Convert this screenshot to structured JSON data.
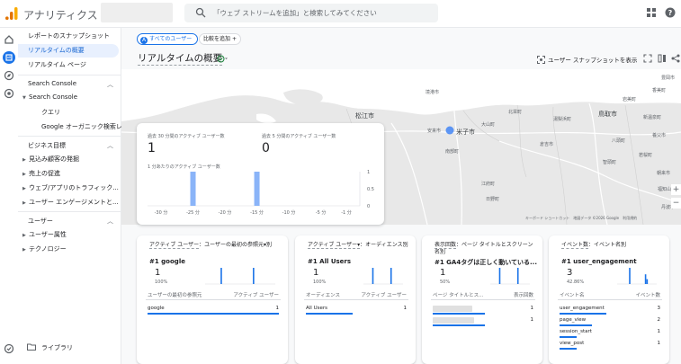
{
  "app": {
    "title": "アナリティクス"
  },
  "search": {
    "placeholder": "「ウェブ ストリームを追加」と検索してみてください"
  },
  "nav": {
    "items": [
      {
        "label": "レポートのスナップショット",
        "active": false
      },
      {
        "label": "リアルタイムの概要",
        "active": true
      },
      {
        "label": "リアルタイム ページ",
        "active": false
      }
    ],
    "sections": [
      {
        "label": "Search Console"
      },
      {
        "label": "ビジネス目標"
      },
      {
        "label": "ユーザー"
      }
    ],
    "search_console": {
      "group": "Search Console",
      "children": [
        "クエリ",
        "Google オーガニック検索レ..."
      ]
    },
    "business": [
      "見込み顧客の発掘",
      "売上の促進",
      "ウェブ/アプリのトラフィック...",
      "ユーザー エンゲージメントと..."
    ],
    "user": [
      "ユーザー属性",
      "テクノロジー"
    ],
    "library": "ライブラリ"
  },
  "toolbar": {
    "all_users_chip": "すべてのユーザー",
    "add_comparison": "比較を追加",
    "page_title": "リアルタイムの概要",
    "snapshot": "ユーザー スナップショットを表示"
  },
  "map": {
    "labels": [
      {
        "text": "松江市",
        "big": true
      },
      {
        "text": "米子市",
        "big": true
      },
      {
        "text": "鳥取市",
        "big": true
      },
      {
        "text": "倉吉市",
        "big": false
      },
      {
        "text": "安来市",
        "big": false
      },
      {
        "text": "境港市",
        "big": false
      },
      {
        "text": "大山町",
        "big": false
      },
      {
        "text": "南部町",
        "big": false
      },
      {
        "text": "江府町",
        "big": false
      },
      {
        "text": "日野町",
        "big": false
      },
      {
        "text": "八頭町",
        "big": false
      },
      {
        "text": "智頭町",
        "big": false
      },
      {
        "text": "若桜町",
        "big": false
      },
      {
        "text": "北栄町",
        "big": false
      },
      {
        "text": "湯梨浜町",
        "big": false
      },
      {
        "text": "岩美町",
        "big": false
      },
      {
        "text": "香美町",
        "big": false
      },
      {
        "text": "豊岡市",
        "big": false
      },
      {
        "text": "新温泉町",
        "big": false
      },
      {
        "text": "養父市",
        "big": false
      },
      {
        "text": "朝来市",
        "big": false
      },
      {
        "text": "丹波市",
        "big": false
      },
      {
        "text": "福知山市",
        "big": false
      }
    ],
    "footer": "キーボード ショートカット　地図データ ©2026 Google　利用規約"
  },
  "overview": {
    "metric30_label": "過去 30 分間のアクティブ ユーザー数",
    "metric30_value": "1",
    "metric5_label": "過去 5 分間のアクティブ ユーザー数",
    "metric5_value": "0",
    "per_minute_label": "1 分あたりのアクティブ ユーザー数",
    "chart_data": {
      "type": "bar",
      "x_ticks": [
        "-30 分",
        "-25 分",
        "-20 分",
        "-15 分",
        "-10 分",
        "-5 分",
        "-1 分"
      ],
      "y_ticks": [
        "1",
        "0.5",
        "0"
      ],
      "ylim": [
        0,
        1
      ],
      "bars": [
        {
          "minute": -25,
          "value": 1
        },
        {
          "minute": -15,
          "value": 1
        }
      ]
    }
  },
  "cards": [
    {
      "title_prefix": "アクティブ ユーザー",
      "title_suffix": "：ユーザーの最初の参照元▾別",
      "rank_label": "#1 google",
      "big": "1",
      "pct": "100%",
      "col1": "ユーザーの最初の参照元",
      "col2": "アクティブ ユーザー",
      "rows": [
        {
          "label": "google",
          "value": "1"
        }
      ]
    },
    {
      "title_prefix": "アクティブ ユーザー▾",
      "title_suffix": "：オーディエンス別",
      "rank_label": "#1 All Users",
      "big": "1",
      "pct": "100%",
      "col1": "オーディエンス",
      "col2": "アクティブ ユーザー",
      "rows": [
        {
          "label": "All Users",
          "value": "1"
        }
      ]
    },
    {
      "title_prefix": "表示回数",
      "title_suffix": "：ページ タイトルとスクリーン名別",
      "rank_label": "#1 GA4タグは正しく動いている...",
      "big": "1",
      "pct": "50%",
      "col1": "ページ タイトルとス...",
      "col2": "表示回数",
      "rows": [
        {
          "label": "",
          "value": "1"
        },
        {
          "label": "",
          "value": "1"
        }
      ]
    },
    {
      "title_prefix": "イベント数",
      "title_suffix": "：イベント名別",
      "rank_label": "#1 user_engagement",
      "big": "3",
      "pct": "42.86%",
      "col1": "イベント名",
      "col2": "イベント数",
      "rows": [
        {
          "label": "user_engagement",
          "value": "3"
        },
        {
          "label": "page_view",
          "value": "2"
        },
        {
          "label": "session_start",
          "value": "1"
        },
        {
          "label": "view_post",
          "value": "1"
        }
      ]
    }
  ],
  "colors": {
    "accent": "#1a73e8",
    "bar": "#8ab4f8",
    "orange": "#f9ab00"
  }
}
